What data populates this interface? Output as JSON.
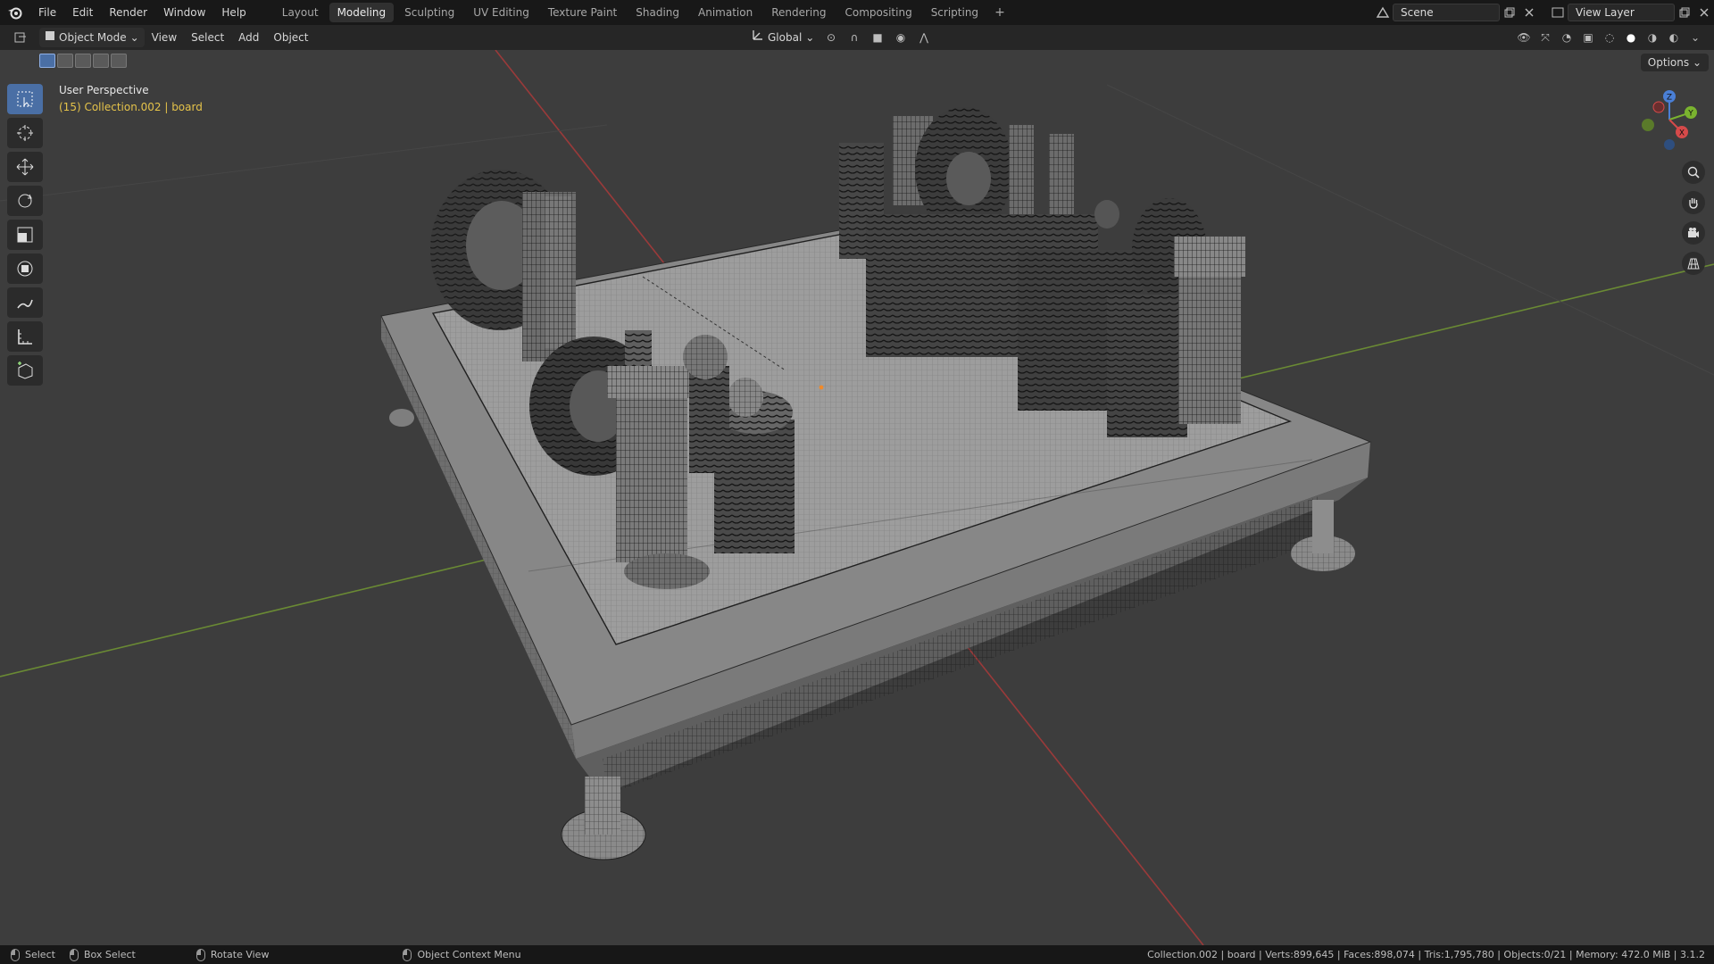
{
  "menu": [
    "File",
    "Edit",
    "Render",
    "Window",
    "Help"
  ],
  "workspaces": [
    {
      "label": "Layout",
      "active": false
    },
    {
      "label": "Modeling",
      "active": true
    },
    {
      "label": "Sculpting",
      "active": false
    },
    {
      "label": "UV Editing",
      "active": false
    },
    {
      "label": "Texture Paint",
      "active": false
    },
    {
      "label": "Shading",
      "active": false
    },
    {
      "label": "Animation",
      "active": false
    },
    {
      "label": "Rendering",
      "active": false
    },
    {
      "label": "Compositing",
      "active": false
    },
    {
      "label": "Scripting",
      "active": false
    }
  ],
  "workspace_add": "+",
  "scene": "Scene",
  "view_layer": "View Layer",
  "header": {
    "mode": "Object Mode",
    "menus": [
      "View",
      "Select",
      "Add",
      "Object"
    ],
    "orientation": "Global",
    "options": "Options"
  },
  "viewport": {
    "perspective": "User Perspective",
    "collection": "(15) Collection.002 | board",
    "collection_color": "#e5c34a",
    "gizmo": {
      "z": "Z",
      "y": "Y",
      "x": "X"
    }
  },
  "toolbar": [
    "select-box-icon",
    "cursor-icon",
    "move-icon",
    "rotate-icon",
    "scale-icon",
    "transform-icon",
    "annotate-icon",
    "measure-icon",
    "add-cube-icon"
  ],
  "statusbar": {
    "select": "Select",
    "box_select": "Box Select",
    "rotate": "Rotate View",
    "context": "Object Context Menu",
    "stats": "Collection.002 | board | Verts:899,645 | Faces:898,074 | Tris:1,795,780 | Objects:0/21 | Memory: 472.0 MiB | 3.1.2"
  }
}
